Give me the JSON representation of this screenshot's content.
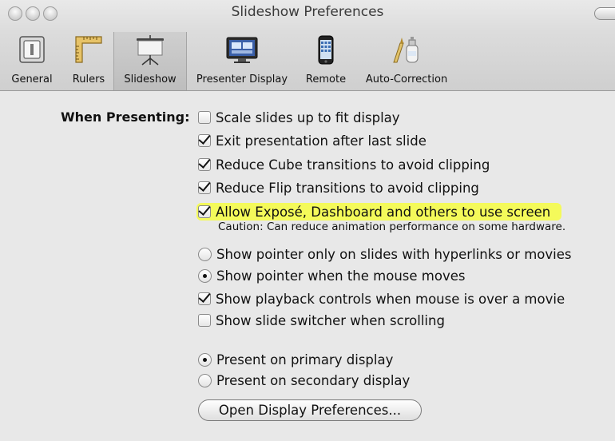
{
  "window": {
    "title": "Slideshow Preferences"
  },
  "toolbar": {
    "items": [
      {
        "label": "General",
        "icon": "general-icon"
      },
      {
        "label": "Rulers",
        "icon": "ruler-icon"
      },
      {
        "label": "Slideshow",
        "icon": "projector-screen-icon",
        "selected": true
      },
      {
        "label": "Presenter Display",
        "icon": "display-icon"
      },
      {
        "label": "Remote",
        "icon": "iphone-remote-icon"
      },
      {
        "label": "Auto-Correction",
        "icon": "auto-correction-icon"
      }
    ]
  },
  "presenting": {
    "heading": "When Presenting:",
    "options": [
      {
        "label": "Scale slides up to fit display",
        "checked": false
      },
      {
        "label": "Exit presentation after last slide",
        "checked": true
      },
      {
        "label": "Reduce Cube transitions to avoid clipping",
        "checked": true
      },
      {
        "label": "Reduce Flip transitions to avoid clipping",
        "checked": true
      },
      {
        "label": "Allow Exposé, Dashboard and others to use screen",
        "checked": true,
        "highlighted": true
      }
    ],
    "caution": "Caution: Can reduce animation performance on some hardware."
  },
  "pointer": {
    "options": [
      {
        "label": "Show pointer only on slides with hyperlinks or movies",
        "selected": false
      },
      {
        "label": "Show pointer when the mouse moves",
        "selected": true
      }
    ]
  },
  "playback": {
    "options": [
      {
        "label": "Show playback controls when mouse is over a movie",
        "checked": true
      },
      {
        "label": "Show slide switcher when scrolling",
        "checked": false
      }
    ]
  },
  "display": {
    "options": [
      {
        "label": "Present on primary display",
        "selected": true
      },
      {
        "label": "Present on secondary display",
        "selected": false
      }
    ],
    "button_label": "Open Display Preferences..."
  },
  "colors": {
    "highlight": "#f4fa5a",
    "window_bg": "#e8e8e8"
  }
}
